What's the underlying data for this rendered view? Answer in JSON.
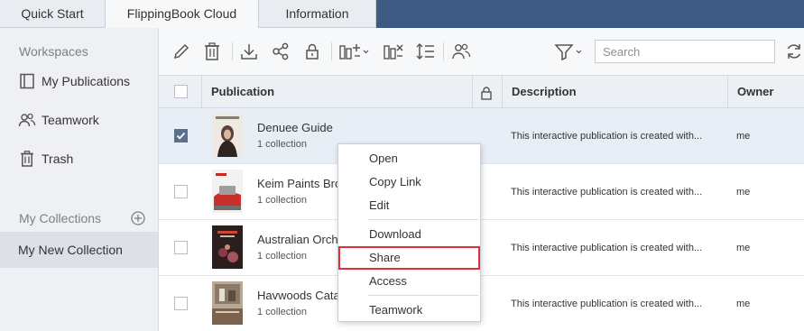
{
  "tabs": [
    {
      "label": "Quick Start"
    },
    {
      "label": "FlippingBook Cloud",
      "active": true
    },
    {
      "label": "Information"
    }
  ],
  "sidebar": {
    "workspaces_heading": "Workspaces",
    "items": [
      {
        "label": "My Publications",
        "icon": "book-icon"
      },
      {
        "label": "Teamwork",
        "icon": "users-icon"
      },
      {
        "label": "Trash",
        "icon": "trash-icon"
      }
    ],
    "collections_heading": "My Collections",
    "collections": [
      {
        "label": "My New Collection",
        "selected": true
      }
    ]
  },
  "toolbar": {
    "icons": [
      "pencil-icon",
      "trash-icon",
      "download-icon",
      "share-icon",
      "lock-icon",
      "add-column-icon",
      "remove-column-icon",
      "line-spacing-icon",
      "users-icon",
      "filter-icon",
      "refresh-icon"
    ],
    "search_placeholder": "Search"
  },
  "table": {
    "columns": [
      "Publication",
      "",
      "Description",
      "Owner"
    ],
    "rows": [
      {
        "title": "Denuee Guide",
        "collections": "1 collection",
        "description": "This interactive publication is created with...",
        "owner": "me",
        "checked": true
      },
      {
        "title": "Keim Paints Bro",
        "collections": "1 collection",
        "description": "This interactive publication is created with...",
        "owner": "me",
        "checked": false
      },
      {
        "title": "Australian Orch",
        "collections": "1 collection",
        "description": "This interactive publication is created with...",
        "owner": "me",
        "checked": false
      },
      {
        "title": "Havwoods Cata",
        "collections": "1 collection",
        "description": "This interactive publication is created with...",
        "owner": "me",
        "checked": false
      }
    ]
  },
  "context_menu": {
    "items": [
      "Open",
      "Copy Link",
      "Edit",
      "Download",
      "Share",
      "Access",
      "Teamwork"
    ],
    "highlighted": "Share",
    "highlight_color": "#e02f3a"
  },
  "colors": {
    "tabbar_bg": "#3e5a82",
    "checkbox_checked": "#5b6f8e",
    "selected_row": "#e8eef6"
  }
}
